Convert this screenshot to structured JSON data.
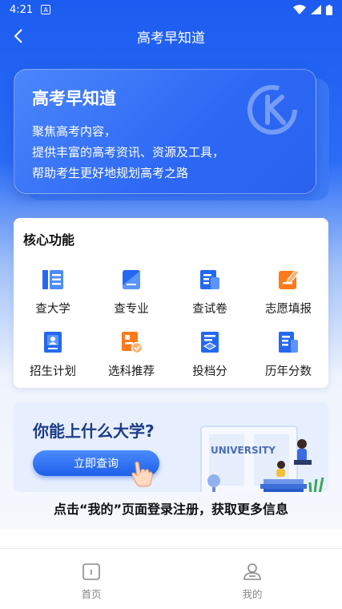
{
  "status_bar": {
    "time": "4:21"
  },
  "nav": {
    "title": "高考早知道"
  },
  "hero": {
    "title": "高考早知道",
    "lines": [
      "聚焦高考内容，",
      "提供丰富的高考资讯、资源及工具，",
      "帮助考生更好地规划高考之路"
    ]
  },
  "features": {
    "title": "核心功能",
    "items": [
      {
        "label": "查大学",
        "icon": "university-icon"
      },
      {
        "label": "查专业",
        "icon": "major-book-icon"
      },
      {
        "label": "查试卷",
        "icon": "exam-paper-icon"
      },
      {
        "label": "志愿填报",
        "icon": "application-form-icon"
      },
      {
        "label": "招生计划",
        "icon": "enrollment-plan-icon"
      },
      {
        "label": "选科推荐",
        "icon": "subject-select-icon"
      },
      {
        "label": "投档分",
        "icon": "admission-score-icon"
      },
      {
        "label": "历年分数",
        "icon": "history-score-icon"
      }
    ]
  },
  "banner": {
    "title": "你能上什么大学?",
    "button_label": "立即查询",
    "illustration_text": "UNIVERSITY"
  },
  "tip": "点击“我的”页面登录注册，获取更多信息",
  "tabs": [
    {
      "label": "首页",
      "icon": "home-icon"
    },
    {
      "label": "我的",
      "icon": "profile-icon"
    }
  ],
  "colors": {
    "primary": "#2a6cf6",
    "accent_orange": "#ff7a1a"
  }
}
